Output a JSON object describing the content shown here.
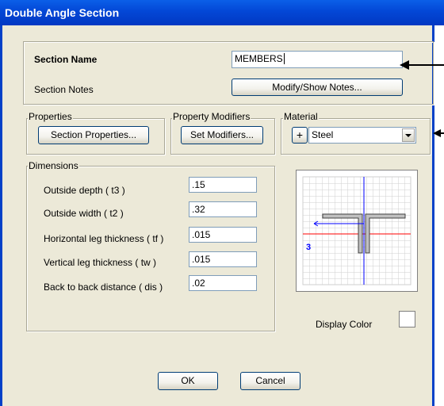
{
  "window": {
    "title": "Double Angle Section"
  },
  "section": {
    "name_label": "Section Name",
    "name_value": "MEMBERS",
    "notes_label": "Section Notes",
    "notes_button": "Modify/Show Notes..."
  },
  "properties": {
    "legend": "Properties",
    "button": "Section Properties..."
  },
  "modifiers": {
    "legend": "Property Modifiers",
    "button": "Set Modifiers..."
  },
  "material": {
    "legend": "Material",
    "plus_label": "+",
    "selected": "Steel"
  },
  "dimensions": {
    "legend": "Dimensions",
    "rows": [
      {
        "label": "Outside depth  ( t3 )",
        "value": ".15"
      },
      {
        "label": "Outside width  ( t2 )",
        "value": ".32"
      },
      {
        "label": "Horizontal leg thickness  ( tf )",
        "value": ".015"
      },
      {
        "label": "Vertical leg thickness  ( tw )",
        "value": ".015"
      },
      {
        "label": "Back to back distance  ( dis )",
        "value": ".02"
      }
    ]
  },
  "preview": {
    "axis_label": "3"
  },
  "display_color": {
    "label": "Display Color"
  },
  "footer": {
    "ok": "OK",
    "cancel": "Cancel"
  },
  "colors": {
    "titlebar": "#0347d6",
    "dialog_bg": "#ece9d8",
    "axis_red": "#ff0000",
    "axis_blue": "#0000ff",
    "shape_fill": "#c0c0c0"
  }
}
